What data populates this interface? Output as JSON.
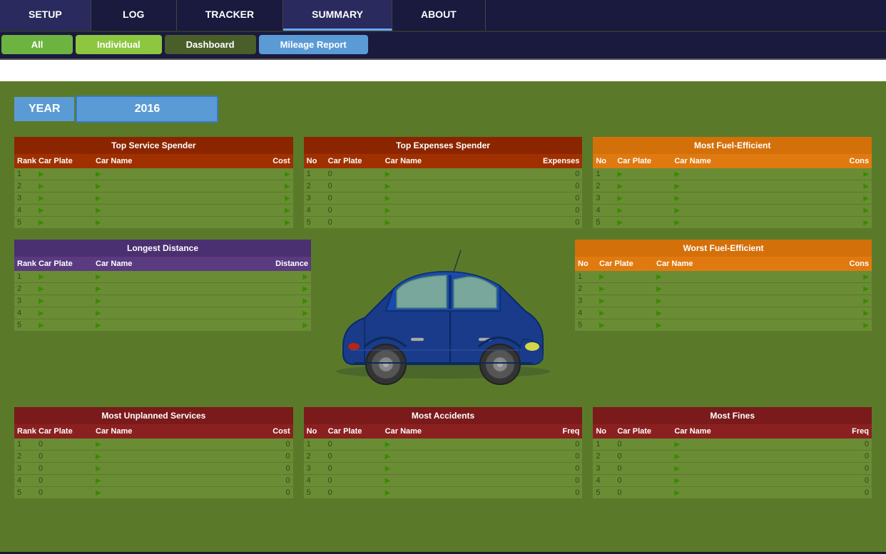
{
  "nav": {
    "tabs": [
      {
        "label": "SETUP",
        "active": false
      },
      {
        "label": "LOG",
        "active": false
      },
      {
        "label": "TRACKER",
        "active": false
      },
      {
        "label": "SUMMARY",
        "active": true
      },
      {
        "label": "ABOUT",
        "active": false
      }
    ],
    "subtabs": [
      {
        "label": "All",
        "style": "green"
      },
      {
        "label": "Individual",
        "style": "green-light"
      },
      {
        "label": "Dashboard",
        "style": "olive"
      },
      {
        "label": "Mileage Report",
        "style": "blue-active"
      }
    ]
  },
  "year": {
    "label": "YEAR",
    "value": "2016"
  },
  "topServiceSpender": {
    "title": "Top Service Spender",
    "headers": [
      "Rank",
      "Car Plate",
      "Car Name",
      "Cost"
    ],
    "rows": [
      {
        "rank": "1",
        "plate": "",
        "name": "",
        "cost": ""
      },
      {
        "rank": "2",
        "plate": "",
        "name": "",
        "cost": ""
      },
      {
        "rank": "3",
        "plate": "",
        "name": "",
        "cost": ""
      },
      {
        "rank": "4",
        "plate": "",
        "name": "",
        "cost": ""
      },
      {
        "rank": "5",
        "plate": "",
        "name": "",
        "cost": ""
      }
    ]
  },
  "topExpensesSpender": {
    "title": "Top Expenses Spender",
    "headers": [
      "No",
      "Car Plate",
      "Car Name",
      "Expenses"
    ],
    "rows": [
      {
        "no": "1",
        "plate": "0",
        "name": "",
        "expenses": "0"
      },
      {
        "no": "2",
        "plate": "0",
        "name": "",
        "expenses": "0"
      },
      {
        "no": "3",
        "plate": "0",
        "name": "",
        "expenses": "0"
      },
      {
        "no": "4",
        "plate": "0",
        "name": "",
        "expenses": "0"
      },
      {
        "no": "5",
        "plate": "0",
        "name": "",
        "expenses": "0"
      }
    ]
  },
  "mostFuelEfficient": {
    "title": "Most Fuel-Efficient",
    "headers": [
      "No",
      "Car Plate",
      "Car Name",
      "Cons"
    ],
    "rows": [
      {
        "no": "1",
        "plate": "",
        "name": "",
        "cons": ""
      },
      {
        "no": "2",
        "plate": "",
        "name": "",
        "cons": ""
      },
      {
        "no": "3",
        "plate": "",
        "name": "",
        "cons": ""
      },
      {
        "no": "4",
        "plate": "",
        "name": "",
        "cons": ""
      },
      {
        "no": "5",
        "plate": "",
        "name": "",
        "cons": ""
      }
    ]
  },
  "longestDistance": {
    "title": "Longest Distance",
    "headers": [
      "Rank",
      "Car Plate",
      "Car Name",
      "Distance"
    ],
    "rows": [
      {
        "rank": "1",
        "plate": "",
        "name": "",
        "distance": ""
      },
      {
        "rank": "2",
        "plate": "",
        "name": "",
        "distance": ""
      },
      {
        "rank": "3",
        "plate": "",
        "name": "",
        "distance": ""
      },
      {
        "rank": "4",
        "plate": "",
        "name": "",
        "distance": ""
      },
      {
        "rank": "5",
        "plate": "",
        "name": "",
        "distance": ""
      }
    ]
  },
  "worstFuelEfficient": {
    "title": "Worst Fuel-Efficient",
    "headers": [
      "No",
      "Car Plate",
      "Car Name",
      "Cons"
    ],
    "rows": [
      {
        "no": "1",
        "plate": "",
        "name": "",
        "cons": ""
      },
      {
        "no": "2",
        "plate": "",
        "name": "",
        "cons": ""
      },
      {
        "no": "3",
        "plate": "",
        "name": "",
        "cons": ""
      },
      {
        "no": "4",
        "plate": "",
        "name": "",
        "cons": ""
      },
      {
        "no": "5",
        "plate": "",
        "name": "",
        "cons": ""
      }
    ]
  },
  "mostUnplannedServices": {
    "title": "Most Unplanned Services",
    "headers": [
      "Rank",
      "Car Plate",
      "Car Name",
      "Cost"
    ],
    "rows": [
      {
        "rank": "1",
        "plate": "0",
        "name": "",
        "cost": "0"
      },
      {
        "rank": "2",
        "plate": "0",
        "name": "",
        "cost": "0"
      },
      {
        "rank": "3",
        "plate": "0",
        "name": "",
        "cost": "0"
      },
      {
        "rank": "4",
        "plate": "0",
        "name": "",
        "cost": "0"
      },
      {
        "rank": "5",
        "plate": "0",
        "name": "",
        "cost": "0"
      }
    ]
  },
  "mostAccidents": {
    "title": "Most Accidents",
    "headers": [
      "No",
      "Car Plate",
      "Car Name",
      "Freq"
    ],
    "rows": [
      {
        "no": "1",
        "plate": "0",
        "name": "",
        "freq": "0"
      },
      {
        "no": "2",
        "plate": "0",
        "name": "",
        "freq": "0"
      },
      {
        "no": "3",
        "plate": "0",
        "name": "",
        "freq": "0"
      },
      {
        "no": "4",
        "plate": "0",
        "name": "",
        "freq": "0"
      },
      {
        "no": "5",
        "plate": "0",
        "name": "",
        "freq": "0"
      }
    ]
  },
  "mostFines": {
    "title": "Most Fines",
    "headers": [
      "No",
      "Car Plate",
      "Car Name",
      "Freq"
    ],
    "rows": [
      {
        "no": "1",
        "plate": "0",
        "name": "",
        "freq": "0"
      },
      {
        "no": "2",
        "plate": "0",
        "name": "",
        "freq": "0"
      },
      {
        "no": "3",
        "plate": "0",
        "name": "",
        "freq": "0"
      },
      {
        "no": "4",
        "plate": "0",
        "name": "",
        "freq": "0"
      },
      {
        "no": "5",
        "plate": "0",
        "name": "",
        "freq": "0"
      }
    ]
  }
}
